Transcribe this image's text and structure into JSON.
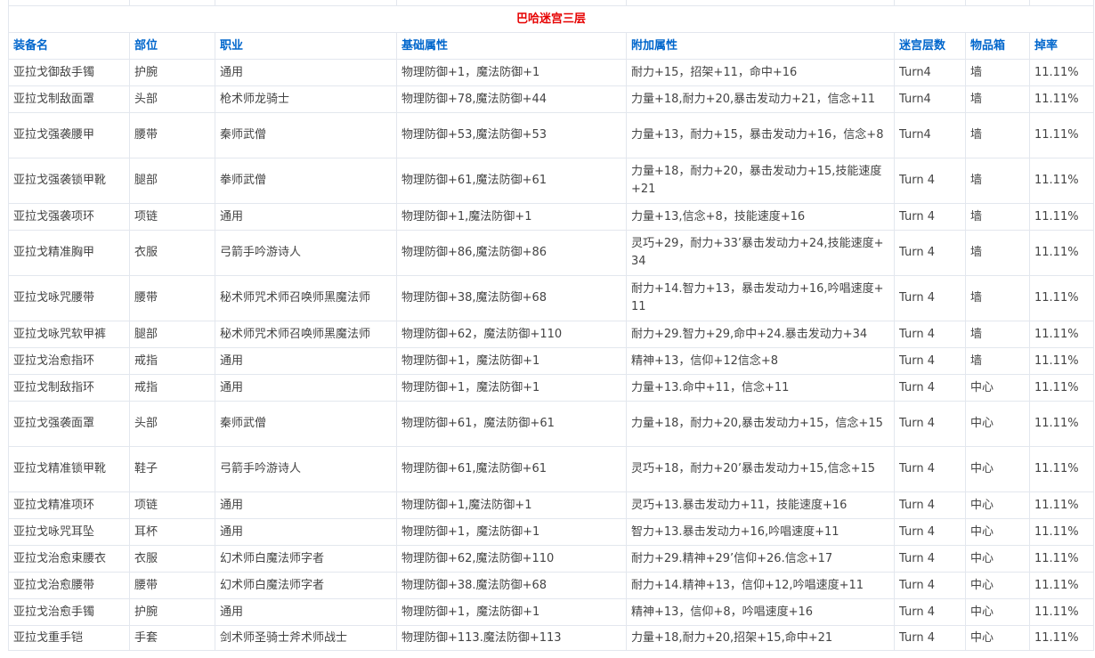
{
  "table": {
    "title": "巴哈迷宫三层",
    "headers": [
      "装备名",
      "部位",
      "职业",
      "基础属性",
      "附加属性",
      "迷宫层数",
      "物品箱",
      "掉率"
    ],
    "rows": [
      [
        "亚拉戈御敌手镯",
        "护腕",
        "通用",
        "物理防御+1，魔法防御+1",
        "耐力+15，招架+11，命中+16",
        "Turn4",
        "墙",
        "11.11%"
      ],
      [
        "亚拉戈制敌面罩",
        "头部",
        "枪术师龙骑士",
        "物理防御+78,魔法防御+44",
        "力量+18,耐力+20,暴击发动力+21，信念+11",
        "Turn4",
        "墙",
        "11.11%"
      ],
      [
        "亚拉戈强袭腰甲",
        "腰带",
        "秦师武僧",
        "物理防御+53,魔法防御+53",
        "力量+13，耐力+15，暴击发动力+16，信念+8",
        "Turn4",
        "墙",
        "11.11%"
      ],
      [
        "亚拉戈强袭锁甲靴",
        "腿部",
        "拳师武僧",
        "物理防御+61,魔法防御+61",
        "力量+18，耐力+20，暴击发动力+15,技能速度+21",
        "Turn 4",
        "墙",
        "11.11%"
      ],
      [
        "亚拉戈强袭项环",
        "项链",
        "通用",
        "物理防御+1,魔法防御+1",
        "力量+13,信念+8，技能速度+16",
        "Turn 4",
        "墙",
        "11.11%"
      ],
      [
        "亚拉戈精准胸甲",
        "衣服",
        "弓箭手吟游诗人",
        "物理防御+86,魔法防御+86",
        "灵巧+29，耐力+33’暴击发动力+24,技能速度+34",
        "Turn 4",
        "墙",
        "11.11%"
      ],
      [
        "亚拉戈咏咒腰带",
        "腰带",
        "秘术师咒术师召唤师黑魔法师",
        "物理防御+38,魔法防御+68",
        "耐力+14.智力+13，暴击发动力+16,吟唱速度+11",
        "Turn 4",
        "墙",
        "11.11%"
      ],
      [
        "亚拉戈咏咒软甲裤",
        "腿部",
        "秘术师咒术师召唤师黑魔法师",
        "物理防御+62，魔法防御+110",
        "耐力+29.智力+29,命中+24.暴击发动力+34",
        "Turn 4",
        "墙",
        "11.11%"
      ],
      [
        "亚拉戈治愈指环",
        "戒指",
        "通用",
        "物理防御+1，魔法防御+1",
        "精神+13，信仰+12信念+8",
        "Turn 4",
        "墙",
        "11.11%"
      ],
      [
        "亚拉戈制敌指环",
        "戒指",
        "通用",
        "物理防御+1，魔法防御+1",
        "力量+13.命中+11，信念+11",
        "Turn 4",
        "中心",
        "11.11%"
      ],
      [
        "亚拉戈强袭面罩",
        "头部",
        "秦师武僧",
        "物理防御+61，魔法防御+61",
        "力量+18，耐力+20,暴击发动力+15，信念+15",
        "Turn 4",
        "中心",
        "11.11%"
      ],
      [
        "亚拉戈精准锁甲靴",
        "鞋子",
        "弓箭手吟游诗人",
        "物理防御+61,魔法防御+61",
        "灵巧+18，耐力+20’暴击发动力+15,信念+15",
        "Turn 4",
        "中心",
        "11.11%"
      ],
      [
        "亚拉戈精准项环",
        "项链",
        "通用",
        "物理防御+1,魔法防御+1",
        "灵巧+13.暴击发动力+11，技能速度+16",
        "Turn 4",
        "中心",
        "11.11%"
      ],
      [
        "亚拉戈咏咒耳坠",
        "耳杯",
        "通用",
        "物理防御+1，魔法防御+1",
        "智力+13.暴击发动力+16,吟唱速度+11",
        "Turn 4",
        "中心",
        "11.11%"
      ],
      [
        "亚拉戈治愈束腰衣",
        "衣服",
        "幻术师白魔法师字者",
        "物理防御+62,魔法防御+110",
        "耐力+29.精神+29’信仰+26.信念+17",
        "Turn 4",
        "中心",
        "11.11%"
      ],
      [
        "亚拉戈治愈腰带",
        "腰带",
        "幻术师白魔法师字者",
        "物理防御+38.魔法防御+68",
        "耐力+14.精神+13，信仰+12,吟唱速度+11",
        "Turn 4",
        "中心",
        "11.11%"
      ],
      [
        "亚拉戈治愈手镯",
        "护腕",
        "通用",
        "物理防御+1，魔法防御+1",
        "精神+13，信仰+8，吟唱速度+16",
        "Turn 4",
        "中心",
        "11.11%"
      ],
      [
        "亚拉戈重手铠",
        "手套",
        "剑术师圣骑士斧术师战士",
        "物理防御+113.魔法防御+113",
        "力量+18,耐力+20,招架+15,命中+21",
        "Turn 4",
        "中心",
        "11.11%"
      ]
    ]
  }
}
